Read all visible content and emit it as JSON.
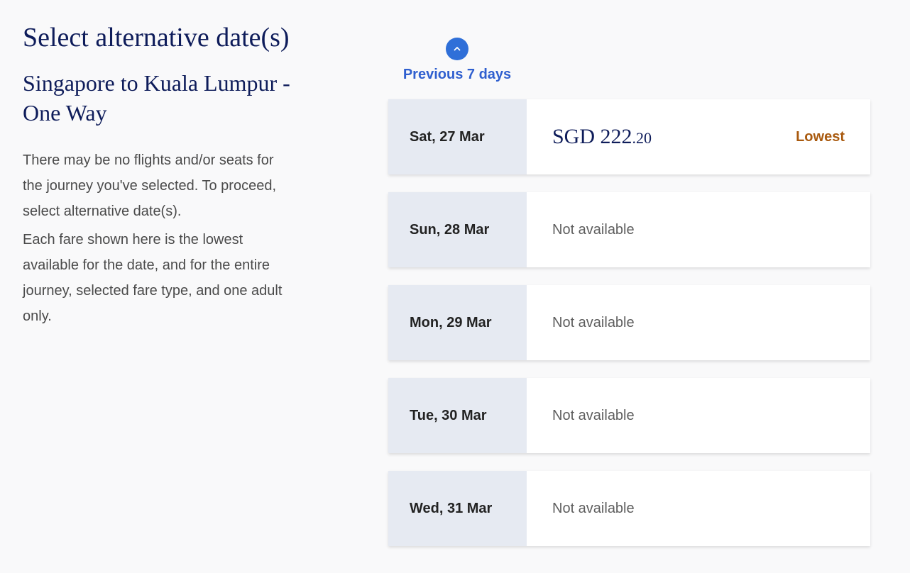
{
  "page": {
    "title": "Select alternative date(s)",
    "route": "Singapore to Kuala Lumpur - One Way",
    "info": [
      "There may be no flights and/or seats for the journey you've selected. To proceed, select alternative date(s).",
      "Each fare shown here is the lowest available for the date, and for the entire journey, selected fare type, and one adult only."
    ]
  },
  "nav": {
    "previous_label": "Previous 7 days",
    "previous_icon": "chevron-up-icon"
  },
  "dates": [
    {
      "date": "Sat, 27 Mar",
      "currency": "SGD",
      "amount_main": "222",
      "amount_cents": ".20",
      "badge": "Lowest"
    },
    {
      "date": "Sun, 28 Mar",
      "status": "Not available"
    },
    {
      "date": "Mon, 29 Mar",
      "status": "Not available"
    },
    {
      "date": "Tue, 30 Mar",
      "status": "Not available"
    },
    {
      "date": "Wed, 31 Mar",
      "status": "Not available"
    }
  ],
  "colors": {
    "background": "#f9f9fa",
    "heading": "#0e1c5a",
    "link": "#2f5fcf",
    "accent_circle": "#2f6fd8",
    "date_cell": "#e6eaf2",
    "lowest_badge": "#a95a0f"
  }
}
